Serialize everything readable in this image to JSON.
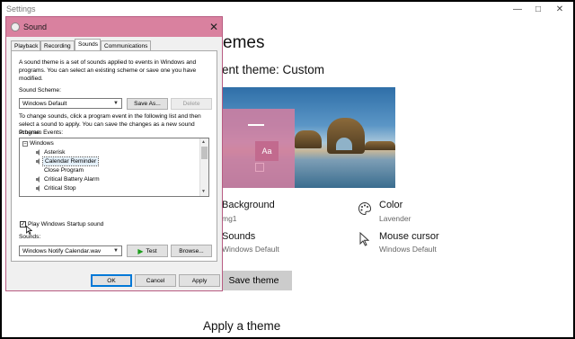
{
  "settings": {
    "title": "Settings",
    "heading_themes": "emes",
    "heading_current": "ent theme: Custom",
    "preview_aa": "Aa",
    "background": {
      "title": "Background",
      "value": "mg1"
    },
    "color": {
      "title": "Color",
      "value": "Lavender"
    },
    "sounds": {
      "title": "Sounds",
      "value": "Windows Default"
    },
    "cursor": {
      "title": "Mouse cursor",
      "value": "Windows Default"
    },
    "save_theme": "Save theme",
    "apply_theme": "Apply a theme"
  },
  "dialog": {
    "title": "Sound",
    "tabs": [
      "Playback",
      "Recording",
      "Sounds",
      "Communications"
    ],
    "active_tab": "Sounds",
    "intro": "A sound theme is a set of sounds applied to events in Windows and programs.  You can select an existing scheme or save one you have modified.",
    "scheme_label": "Sound Scheme:",
    "scheme_value": "Windows Default",
    "save_as": "Save As...",
    "delete": "Delete",
    "instructions": "To change sounds, click a program event in the following list and then select a sound to apply.  You can save the changes as a new sound scheme.",
    "events_label": "Program Events:",
    "events": [
      {
        "label": "Windows",
        "group": true,
        "selected": false
      },
      {
        "label": "Asterisk",
        "group": false,
        "selected": false
      },
      {
        "label": "Calendar Reminder",
        "group": false,
        "selected": true
      },
      {
        "label": "Close Program",
        "group": false,
        "selected": false
      },
      {
        "label": "Critical Battery Alarm",
        "group": false,
        "selected": false
      },
      {
        "label": "Critical Stop",
        "group": false,
        "selected": false
      }
    ],
    "startup_label": "Play Windows Startup sound",
    "startup_checked": true,
    "sounds_label": "Sounds:",
    "sound_value": "Windows Notify Calendar.wav",
    "test": "Test",
    "browse": "Browse...",
    "ok": "OK",
    "cancel": "Cancel",
    "apply": "Apply"
  },
  "colors": {
    "accent_pink": "#d9819f",
    "lavender": "#d07ea0",
    "test_green": "#1e9e1e"
  }
}
